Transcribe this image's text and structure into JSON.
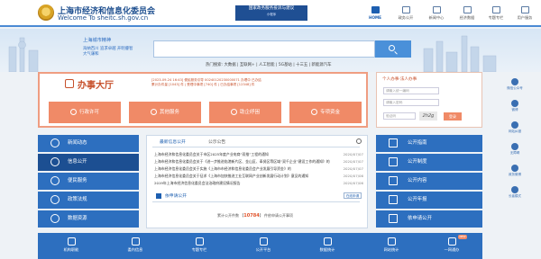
{
  "header": {
    "title_cn": "上海市经济和信息化委员会",
    "title_en": "Welcome To sheitc.sh.gov.cn",
    "banner_main": "国家政务服务投诉与建议",
    "banner_sub": "小程序",
    "nav": [
      {
        "label": "HOME",
        "icon": "home-icon",
        "active": true
      },
      {
        "label": "政务公开",
        "icon": "document-icon",
        "active": false
      },
      {
        "label": "新闻中心",
        "icon": "news-icon",
        "active": false
      },
      {
        "label": "经济数据",
        "icon": "chart-icon",
        "active": false
      },
      {
        "label": "专题专栏",
        "icon": "folder-icon",
        "active": false
      },
      {
        "label": "用户服务",
        "icon": "user-icon",
        "active": false
      }
    ]
  },
  "hero": {
    "hotwords_title": "上海城市精神",
    "hotwords": "海纳百川 追求卓越 开明睿智 大气谦和",
    "search_placeholder": "",
    "hotline": "热门搜索: 大数据 | 互联网+ | 人工智能 | 5G基站 | 十三五 | 新能源汽车"
  },
  "services": {
    "title": "办事大厅",
    "notice_lines": [
      "[2023-09-24 16:43] 便民服务引导 00240120230000071 办理中 已办结",
      "累计办件量 [1043] 件 | 受理中事项 [740] 件 | 已办结事项 [12348] 件"
    ],
    "items": [
      {
        "label": "行政许可"
      },
      {
        "label": "其他服务"
      },
      {
        "label": "助企纾困"
      },
      {
        "label": "专项资金"
      }
    ]
  },
  "login": {
    "title": "个人办事·法人办事",
    "username_placeholder": "请输入统一编码",
    "password_placeholder": "请输入密码",
    "captcha_placeholder": "验证码",
    "captcha_text": "2h2g",
    "login_label": "登录"
  },
  "side_float": [
    {
      "label": "微信公众号",
      "icon": "wechat-icon"
    },
    {
      "label": "微博",
      "icon": "weibo-icon"
    },
    {
      "label": "网站纠错",
      "icon": "feedback-icon"
    },
    {
      "label": "无障碍",
      "icon": "accessibility-icon"
    },
    {
      "label": "政务微博",
      "icon": "weibo-icon"
    },
    {
      "label": "长者模式",
      "icon": "elder-icon"
    }
  ],
  "left_nav": [
    {
      "label": "新闻动态",
      "icon": "news-icon"
    },
    {
      "label": "信息公开",
      "icon": "info-icon"
    },
    {
      "label": "便民服务",
      "icon": "service-icon"
    },
    {
      "label": "政策法规",
      "icon": "law-icon"
    },
    {
      "label": "数据资源",
      "icon": "data-icon"
    }
  ],
  "center": {
    "tabs": [
      "最新信息公开",
      "公示公告"
    ],
    "news": [
      {
        "title": "上海市经济和信息化委员会关于市区2025年度产业电商“双推”工程的通知",
        "date": "2020/07/07"
      },
      {
        "title": "上海市经济和信息化委员会关于《进一步推进临港新片区、金山区、奉贤区等区域“双千企业”建设工作的通知》的",
        "date": "2020/07/07"
      },
      {
        "title": "上海市经济信息化委员会关于实施《上海市市经济和信息化委员会产业发展引导资金》的",
        "date": "2020/07/07"
      },
      {
        "title": "上海市经济信息化委员会关于征求《上海市加快推进工业互联网产业创新发展行动计划》意见的通知",
        "date": "2020/07/06"
      },
      {
        "title": "2019年上海市经济信息化委员会法治政府建设情况报告",
        "date": "2020/07/06"
      }
    ],
    "apply_title": "依申请公开",
    "apply_btn": "在线申请",
    "apply_count_prefix": "累计公开件数",
    "apply_count": "10784",
    "apply_count_suffix": "件依申请公开事项"
  },
  "right_list": [
    {
      "label": "公开指南",
      "icon": "guide-icon"
    },
    {
      "label": "公开制度",
      "icon": "rule-icon"
    },
    {
      "label": "公开内容",
      "icon": "content-icon"
    },
    {
      "label": "公开年报",
      "icon": "report-icon"
    },
    {
      "label": "依申请公开",
      "icon": "apply-icon"
    }
  ],
  "bottom_bar": [
    {
      "label": "机构职能",
      "icon": "org-icon"
    },
    {
      "label": "委内信息",
      "icon": "doc-icon"
    },
    {
      "label": "专题专栏",
      "icon": "topic-icon"
    },
    {
      "label": "公开平台",
      "icon": "platform-icon"
    },
    {
      "label": "数据统计",
      "icon": "chart-icon"
    },
    {
      "label": "网站统计",
      "icon": "stats-icon"
    },
    {
      "label": "一网通办",
      "icon": "oneweb-icon",
      "badge": "NEW"
    }
  ]
}
